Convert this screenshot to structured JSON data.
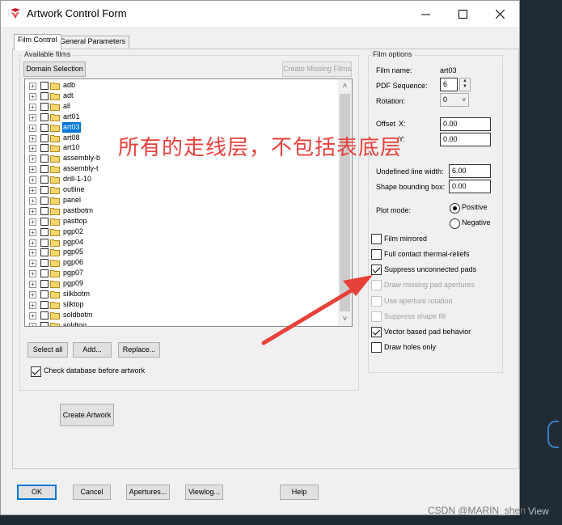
{
  "window": {
    "title": "Artwork Control Form"
  },
  "tabs": [
    {
      "label": "Film Control",
      "active": true
    },
    {
      "label": "General Parameters",
      "active": false
    }
  ],
  "available_films": {
    "group_label": "Available films",
    "domain_button": "Domain Selection",
    "create_missing_button": "Create Missing Films",
    "items": [
      {
        "label": "adb",
        "selected": false
      },
      {
        "label": "adt",
        "selected": false
      },
      {
        "label": "all",
        "selected": false
      },
      {
        "label": "art01",
        "selected": false
      },
      {
        "label": "art03",
        "selected": true
      },
      {
        "label": "art08",
        "selected": false
      },
      {
        "label": "art10",
        "selected": false
      },
      {
        "label": "assembly-b",
        "selected": false
      },
      {
        "label": "assembly-t",
        "selected": false
      },
      {
        "label": "drill-1-10",
        "selected": false
      },
      {
        "label": "outline",
        "selected": false
      },
      {
        "label": "panel",
        "selected": false
      },
      {
        "label": "pastbotm",
        "selected": false
      },
      {
        "label": "pasttop",
        "selected": false
      },
      {
        "label": "pgp02",
        "selected": false
      },
      {
        "label": "pgp04",
        "selected": false
      },
      {
        "label": "pgp05",
        "selected": false
      },
      {
        "label": "pgp06",
        "selected": false
      },
      {
        "label": "pgp07",
        "selected": false
      },
      {
        "label": "pgp09",
        "selected": false
      },
      {
        "label": "silkbotm",
        "selected": false
      },
      {
        "label": "silktop",
        "selected": false
      },
      {
        "label": "soldbotm",
        "selected": false
      },
      {
        "label": "soldtop",
        "selected": false
      }
    ],
    "select_all_button": "Select all",
    "add_button": "Add...",
    "replace_button": "Replace...",
    "check_database_label": "Check database before artwork",
    "check_database_checked": true,
    "create_artwork_button": "Create Artwork"
  },
  "film_options": {
    "group_label": "Film options",
    "film_name_label": "Film name:",
    "film_name_value": "art03",
    "pdf_sequence_label": "PDF Sequence:",
    "pdf_sequence_value": "6",
    "rotation_label": "Rotation:",
    "rotation_value": "0",
    "offset_label": "Offset",
    "offset_x_label": "X:",
    "offset_x_value": "0.00",
    "offset_y_label": "Y:",
    "offset_y_value": "0.00",
    "undefined_line_width_label": "Undefined line width:",
    "undefined_line_width_value": "6.00",
    "shape_bounding_box_label": "Shape bounding box:",
    "shape_bounding_box_value": "0.00",
    "plot_mode_label": "Plot mode:",
    "plot_mode_options": [
      "Positive",
      "Negative"
    ],
    "plot_mode_selected": "Positive",
    "checkboxes": [
      {
        "label": "Film mirrored",
        "checked": false,
        "enabled": true
      },
      {
        "label": "Full contact thermal-reliefs",
        "checked": false,
        "enabled": true
      },
      {
        "label": "Suppress unconnected pads",
        "checked": true,
        "enabled": true
      },
      {
        "label": "Draw missing pad apertures",
        "checked": false,
        "enabled": false
      },
      {
        "label": "Use aperture rotation",
        "checked": false,
        "enabled": false
      },
      {
        "label": "Suppress shape fill",
        "checked": false,
        "enabled": false
      },
      {
        "label": "Vector based pad behavior",
        "checked": true,
        "enabled": true
      },
      {
        "label": "Draw holes only",
        "checked": false,
        "enabled": true
      }
    ]
  },
  "footer": {
    "ok": "OK",
    "cancel": "Cancel",
    "apertures": "Apertures...",
    "viewlog": "Viewlog...",
    "help": "Help"
  },
  "annotation": {
    "text": "所有的走线层，不包括表底层",
    "color": "#e8413b"
  },
  "background": {
    "right_edge_text": "View"
  },
  "watermark": "CSDN @MARIN_shen",
  "colors": {
    "selection": "#0078d7",
    "annotation_red": "#e8413b",
    "folder_yellow": "#f5d76e"
  }
}
